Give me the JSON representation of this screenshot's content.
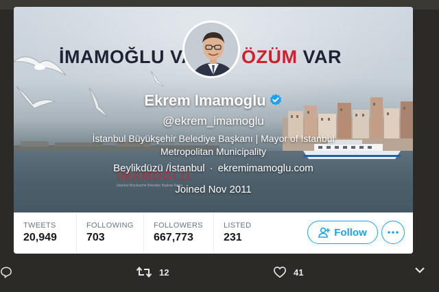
{
  "banner": {
    "slogan_left": "İMAMOĞLU VAR",
    "slogan_right_red": "ÖZÜM",
    "slogan_right_dark": "VAR",
    "watermark": "İMAMOĞLU",
    "watermark_sub": "İstanbul Büyükşehir Belediye Başkan Adayı"
  },
  "profile": {
    "name": "Ekrem Imamoglu",
    "handle": "@ekrem_imamoglu",
    "bio_line1": "İstanbul Büyükşehir Belediye Başkanı | Mayor of Istanbul",
    "bio_line2": "Metropolitan Municipality",
    "location": "Beylikdüzü /İstanbul",
    "separator": "·",
    "website": "ekremimamoglu.com",
    "joined": "Joined Nov 2011"
  },
  "stats": [
    {
      "label": "TWEETS",
      "value": "20,949"
    },
    {
      "label": "FOLLOWING",
      "value": "703"
    },
    {
      "label": "FOLLOWERS",
      "value": "667,773"
    },
    {
      "label": "LISTED",
      "value": "231"
    }
  ],
  "buttons": {
    "follow_label": "Follow",
    "more_icon": "ellipsis-icon"
  },
  "actions": {
    "reply_icon": "reply-icon",
    "retweet_count": "12",
    "like_count": "41",
    "chevron_icon": "chevron-down-icon"
  },
  "colors": {
    "accent": "#1da1f2",
    "slogan_red": "#d0202b",
    "page_bg": "#2b2a26"
  }
}
